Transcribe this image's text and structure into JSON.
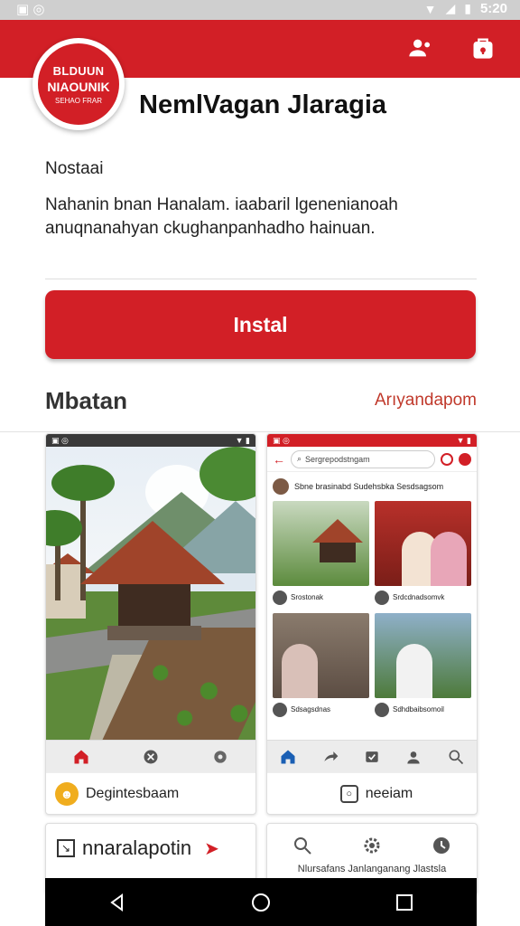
{
  "status_bar": {
    "time": "5:20",
    "left_icons": "▣ ◎"
  },
  "app": {
    "title": "NemlVagan Jlaragia",
    "logo": {
      "line1": "BLDUUN",
      "line2": "NIAOUNIK",
      "line3": "SEHAO FRAR"
    }
  },
  "details": {
    "label": "Nostaai",
    "description": "Nahanin bnan Hanalam. iaabaril lgenenianoah anuqnanahyan ckughanpanhadho hainuan."
  },
  "install_button": {
    "label": "Instal"
  },
  "section": {
    "title": "Mbatan",
    "link": "Arıyandapom"
  },
  "screenshots": [
    {
      "caption": "Degintesbaam",
      "nav_icons": [
        "home-icon",
        "close-icon",
        "settings-icon"
      ]
    },
    {
      "caption": "neeiam",
      "search": "Sergrepodstngam",
      "post_text": "Sbne brasinabd Sudehsbka Sesdsagsom",
      "tiles": [
        {
          "caption": "Srostonak"
        },
        {
          "caption": "Srdcdnadsomvk"
        },
        {
          "caption": "Sdsagsdnas"
        },
        {
          "caption": "Sdhdbaibsomoil"
        }
      ],
      "nav_icons": [
        "home-icon",
        "share-icon",
        "inbox-icon",
        "profile-icon",
        "search-icon"
      ]
    }
  ],
  "bottom_cards": {
    "left_text": "nnaralapotin",
    "right_text": "Nlursafans Janlanganang Jlastsla"
  },
  "colors": {
    "brand": "#d21f26",
    "status_bar": "#cfcfcf",
    "nav": "#000000"
  }
}
